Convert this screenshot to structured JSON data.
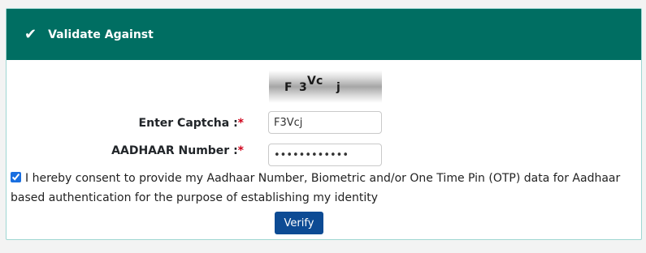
{
  "header": {
    "icon": "checkmark-icon",
    "title": "Validate Against",
    "color": "#006e62"
  },
  "captcha": {
    "image_text": "F 3Vc j",
    "label": "Enter Captcha :",
    "value": "F3Vcj"
  },
  "aadhaar": {
    "label": "AADHAAR Number :",
    "masked_value": "••••••••••••"
  },
  "required_marker": "*",
  "consent": {
    "checked": true,
    "text": "I hereby consent to provide my Aadhaar Number, Biometric and/or One Time Pin (OTP) data for Aadhaar based authentication for the purpose of establishing my identity"
  },
  "verify_label": "Verify",
  "colors": {
    "accent": "#0d4b94",
    "required": "#d0021b"
  }
}
